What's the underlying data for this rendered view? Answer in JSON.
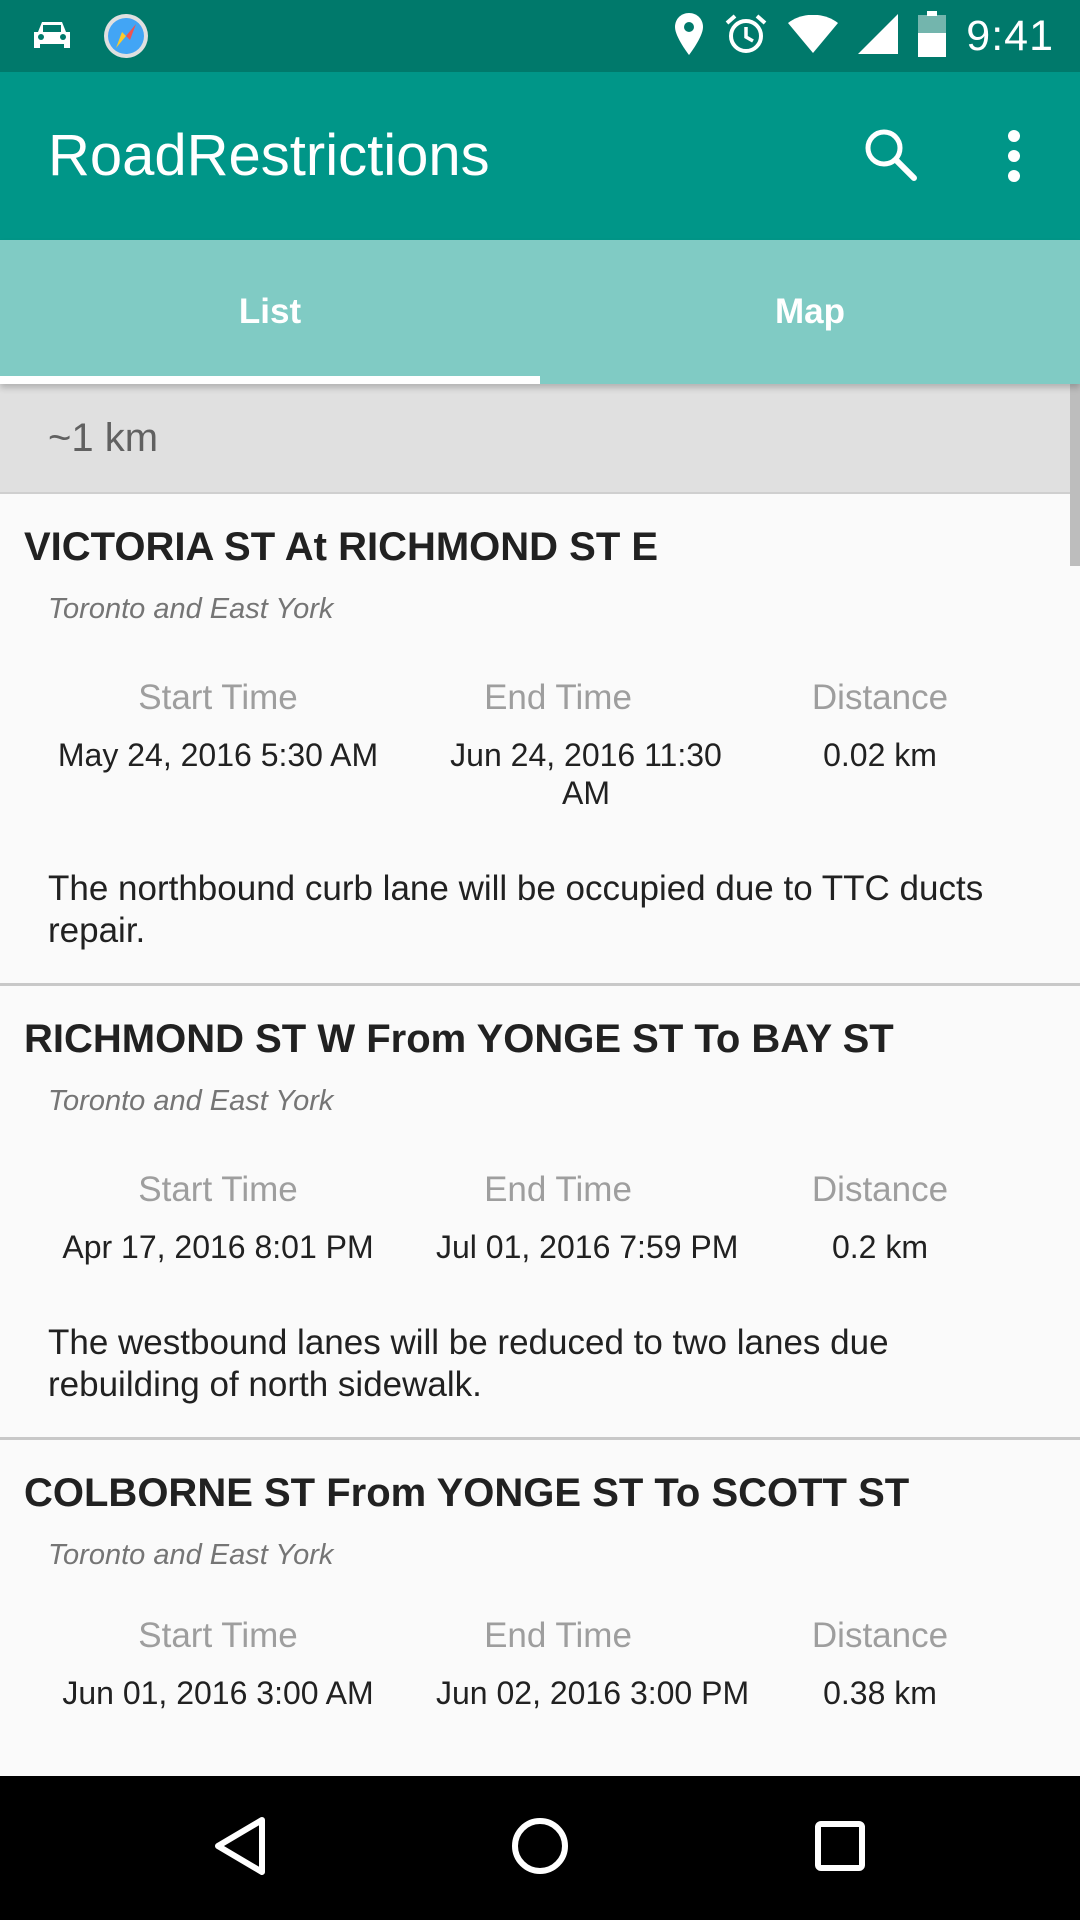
{
  "status_bar": {
    "time": "9:41",
    "icons_left": [
      "car-icon",
      "compass-icon"
    ],
    "icons_right": [
      "location-icon",
      "alarm-icon",
      "wifi-icon",
      "cell-signal-icon",
      "battery-icon"
    ]
  },
  "app_bar": {
    "title": "RoadRestrictions",
    "actions": [
      "search-icon",
      "more-vert-icon"
    ]
  },
  "tabs": [
    {
      "label": "List",
      "selected": true
    },
    {
      "label": "Map",
      "selected": false
    }
  ],
  "section": {
    "header": "~1 km"
  },
  "restrictions": [
    {
      "title": "VICTORIA ST At RICHMOND ST E",
      "region": "Toronto and East York",
      "start_label": "Start Time",
      "start": "May 24, 2016 5:30 AM",
      "end_label": "End Time",
      "end": "Jun 24, 2016 11:30 AM",
      "distance_label": "Distance",
      "distance": "0.02 km",
      "description": "The northbound curb lane will be occupied due to TTC ducts repair."
    },
    {
      "title": "RICHMOND ST W From YONGE ST To BAY ST",
      "region": "Toronto and East York",
      "start_label": "Start Time",
      "start": "Apr 17, 2016 8:01 PM",
      "end_label": "End Time",
      "end": "Jul 01, 2016 7:59 PM",
      "distance_label": "Distance",
      "distance": "0.2 km",
      "description": "The westbound lanes will be reduced to two lanes due rebuilding of north sidewalk."
    },
    {
      "title": "COLBORNE ST From YONGE ST To SCOTT ST",
      "region": "Toronto and East York",
      "start_label": "Start Time",
      "start": "Jun 01, 2016 3:00 AM",
      "end_label": "End Time",
      "end": "Jun 02, 2016 3:00 PM",
      "distance_label": "Distance",
      "distance": "0.38 km",
      "description": ""
    }
  ],
  "nav_bar": {
    "buttons": [
      "back-icon",
      "home-icon",
      "recents-icon"
    ]
  },
  "colors": {
    "status_bar": "#00796b",
    "app_bar": "#009688",
    "tab_bar": "#80cbc4",
    "section_header": "#e0e0e0"
  }
}
